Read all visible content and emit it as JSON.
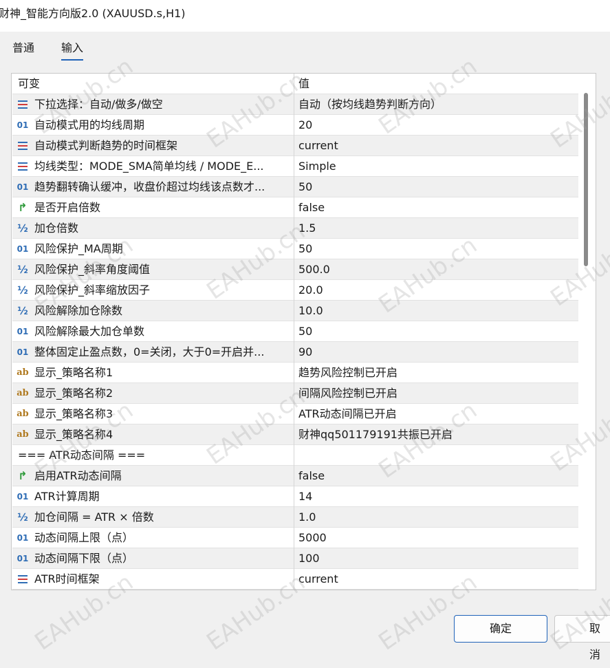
{
  "window": {
    "title": "财神_智能方向版2.0 (XAUUSD.s,H1)"
  },
  "tabs": [
    {
      "label": "普通",
      "active": false
    },
    {
      "label": "输入",
      "active": true
    }
  ],
  "grid": {
    "header": {
      "name": "可变",
      "value": "值"
    },
    "rows": [
      {
        "icon": "enum-icon",
        "name": "下拉选择：自动/做多/做空",
        "value": "自动（按均线趋势判断方向）"
      },
      {
        "icon": "int-icon",
        "name": "自动模式用的均线周期",
        "value": "20"
      },
      {
        "icon": "enum-icon",
        "name": "自动模式判断趋势的时间框架",
        "value": "current"
      },
      {
        "icon": "enum-icon",
        "name": "均线类型：MODE_SMA简单均线 / MODE_E...",
        "value": "Simple"
      },
      {
        "icon": "int-icon",
        "name": "趋势翻转确认缓冲，收盘价超过均线该点数才...",
        "value": "50"
      },
      {
        "icon": "bool-icon",
        "name": "是否开启倍数",
        "value": "false"
      },
      {
        "icon": "double-icon",
        "name": "加仓倍数",
        "value": "1.5"
      },
      {
        "icon": "int-icon",
        "name": "风险保护_MA周期",
        "value": "50"
      },
      {
        "icon": "double-icon",
        "name": "风险保护_斜率角度阈值",
        "value": "500.0"
      },
      {
        "icon": "double-icon",
        "name": "风险保护_斜率缩放因子",
        "value": "20.0"
      },
      {
        "icon": "double-icon",
        "name": "风险解除加仓除数",
        "value": "10.0"
      },
      {
        "icon": "int-icon",
        "name": "风险解除最大加仓单数",
        "value": "50"
      },
      {
        "icon": "int-icon",
        "name": "整体固定止盈点数，0=关闭，大于0=开启并...",
        "value": "90"
      },
      {
        "icon": "string-icon",
        "name": "显示_策略名称1",
        "value": "趋势风险控制已开启"
      },
      {
        "icon": "string-icon",
        "name": "显示_策略名称2",
        "value": "间隔风险控制已开启"
      },
      {
        "icon": "string-icon",
        "name": "显示_策略名称3",
        "value": "ATR动态间隔已开启"
      },
      {
        "icon": "string-icon",
        "name": "显示_策略名称4",
        "value": "财神qq501179191共振已开启"
      },
      {
        "icon": "",
        "name": "=== ATR动态间隔 ===",
        "value": ""
      },
      {
        "icon": "bool-icon",
        "name": "启用ATR动态间隔",
        "value": "false"
      },
      {
        "icon": "int-icon",
        "name": "ATR计算周期",
        "value": "14"
      },
      {
        "icon": "double-icon",
        "name": "加仓间隔 = ATR × 倍数",
        "value": "1.0"
      },
      {
        "icon": "int-icon",
        "name": "动态间隔上限（点）",
        "value": "5000"
      },
      {
        "icon": "int-icon",
        "name": "动态间隔下限（点）",
        "value": "100"
      },
      {
        "icon": "enum-icon",
        "name": "ATR时间框架",
        "value": "current"
      }
    ]
  },
  "icons": {
    "int_glyph": "01",
    "double_glyph": "½",
    "bool_glyph": "↱",
    "string_glyph": "ab"
  },
  "buttons": {
    "ok": "确定",
    "cancel": "取消"
  },
  "watermark": {
    "text": "EAHub.cn"
  },
  "colors": {
    "accent": "#1e62b8",
    "enum_red": "#d23b3b",
    "enum_blue": "#2f6db5",
    "bool_green": "#2e9a3a",
    "string_gold": "#b07a20"
  }
}
